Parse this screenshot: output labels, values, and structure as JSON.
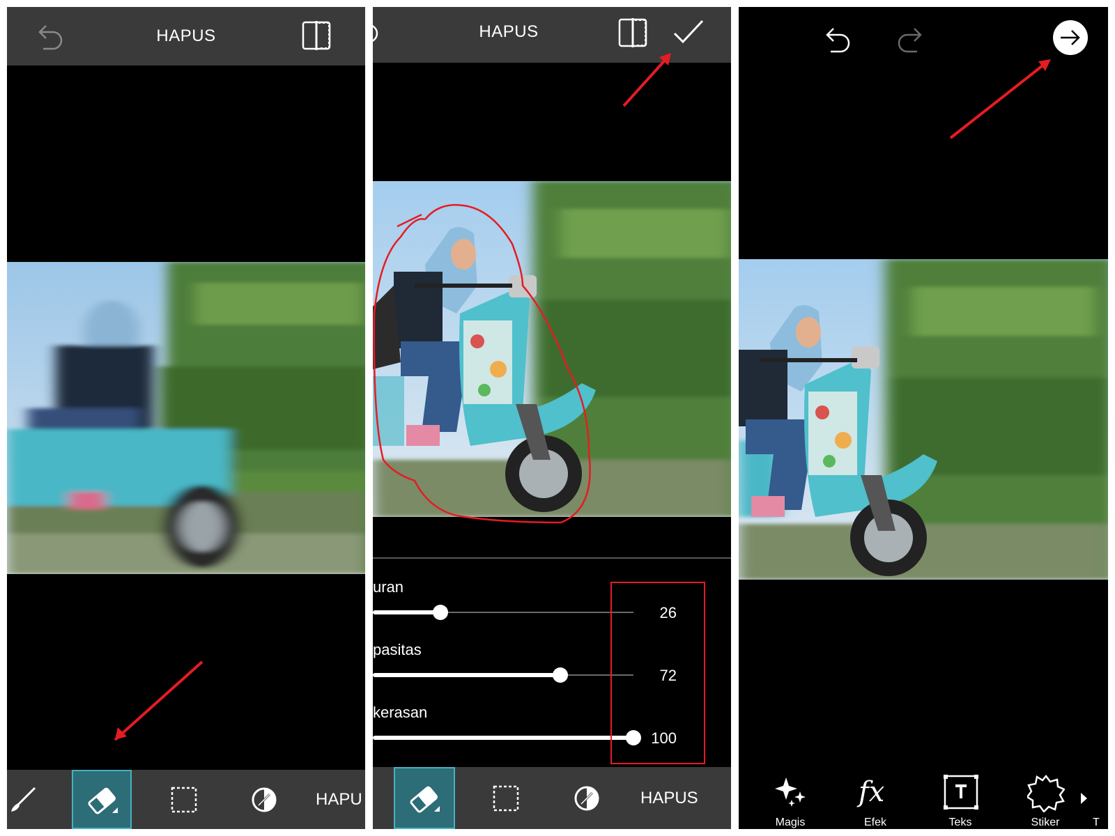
{
  "panel1": {
    "title": "HAPUS",
    "icons": [
      "undo-icon",
      "compare-icon"
    ],
    "tools": [
      {
        "name": "brush-icon"
      },
      {
        "name": "eraser-icon",
        "selected": true
      },
      {
        "name": "selection-icon"
      },
      {
        "name": "invert-icon"
      }
    ],
    "tool_text": "HAPU"
  },
  "panel2": {
    "title": "HAPUS",
    "icons": [
      "compare-icon",
      "apply-checkmark-icon"
    ],
    "sliders": [
      {
        "label": "uran",
        "value": "26",
        "level": 26
      },
      {
        "label": "pasitas",
        "value": "72",
        "level": 72
      },
      {
        "label": "kerasan",
        "value": "100",
        "level": 100
      }
    ],
    "tools": [
      {
        "name": "eraser-icon",
        "selected": true
      },
      {
        "name": "selection-icon"
      },
      {
        "name": "invert-icon"
      }
    ],
    "tool_text": "HAPUS"
  },
  "panel3": {
    "icons": [
      "undo-icon",
      "redo-icon",
      "next-arrow-icon"
    ],
    "menu": [
      {
        "label": "Magis",
        "icon": "sparkle-icon"
      },
      {
        "label": "Efek",
        "icon": "fx-icon"
      },
      {
        "label": "Teks",
        "icon": "text-icon"
      },
      {
        "label": "Stiker",
        "icon": "sticker-icon"
      }
    ],
    "more_label": "T"
  },
  "colors": {
    "annotation_red": "#e51c23",
    "toolbar_bg": "#3a3a3a",
    "selected_tool": "#2c6d77"
  }
}
